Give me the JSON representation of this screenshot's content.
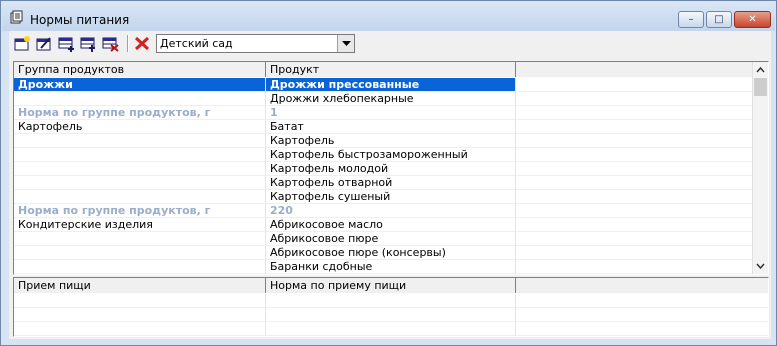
{
  "window": {
    "title": "Нормы питания",
    "controls": {
      "minimize": "minimize-icon",
      "maximize": "maximize-icon",
      "close": "close-icon"
    }
  },
  "toolbar": {
    "buttons": [
      "add-record-icon",
      "edit-record-icon",
      "add-grid-icon",
      "add-subrecord-icon",
      "remove-subrecord-icon"
    ],
    "delete_icon": "delete-x-icon",
    "combo_value": "Детский сад"
  },
  "products_grid": {
    "columns": [
      "Группа продуктов",
      "Продукт",
      ""
    ],
    "rows": [
      {
        "group": "Дрожжи",
        "product": "Дрожжи прессованные",
        "kind": "selected"
      },
      {
        "group": "",
        "product": "Дрожжи хлебопекарные",
        "kind": "normal"
      },
      {
        "group": "Норма по группе продуктов, г",
        "product": "1",
        "kind": "norm"
      },
      {
        "group": "Картофель",
        "product": "Батат",
        "kind": "normal"
      },
      {
        "group": "",
        "product": "Картофель",
        "kind": "normal"
      },
      {
        "group": "",
        "product": "Картофель быстрозамороженный",
        "kind": "normal"
      },
      {
        "group": "",
        "product": "Картофель молодой",
        "kind": "normal"
      },
      {
        "group": "",
        "product": "Картофель отварной",
        "kind": "normal"
      },
      {
        "group": "",
        "product": "Картофель сушеный",
        "kind": "normal"
      },
      {
        "group": "Норма по группе продуктов, г",
        "product": "220",
        "kind": "norm"
      },
      {
        "group": "Кондитерские изделия",
        "product": "Абрикосовое масло",
        "kind": "normal"
      },
      {
        "group": "",
        "product": "Абрикосовое пюре",
        "kind": "normal"
      },
      {
        "group": "",
        "product": "Абрикосовое пюре (консервы)",
        "kind": "normal"
      },
      {
        "group": "",
        "product": "Баранки сдобные",
        "kind": "normal"
      }
    ]
  },
  "meals_grid": {
    "columns": [
      "Прием пищи",
      "Норма по приему пищи",
      ""
    ]
  },
  "colors": {
    "selection": "#0a64d8",
    "norm_text": "#9aaecb",
    "delete_red": "#d42020"
  }
}
